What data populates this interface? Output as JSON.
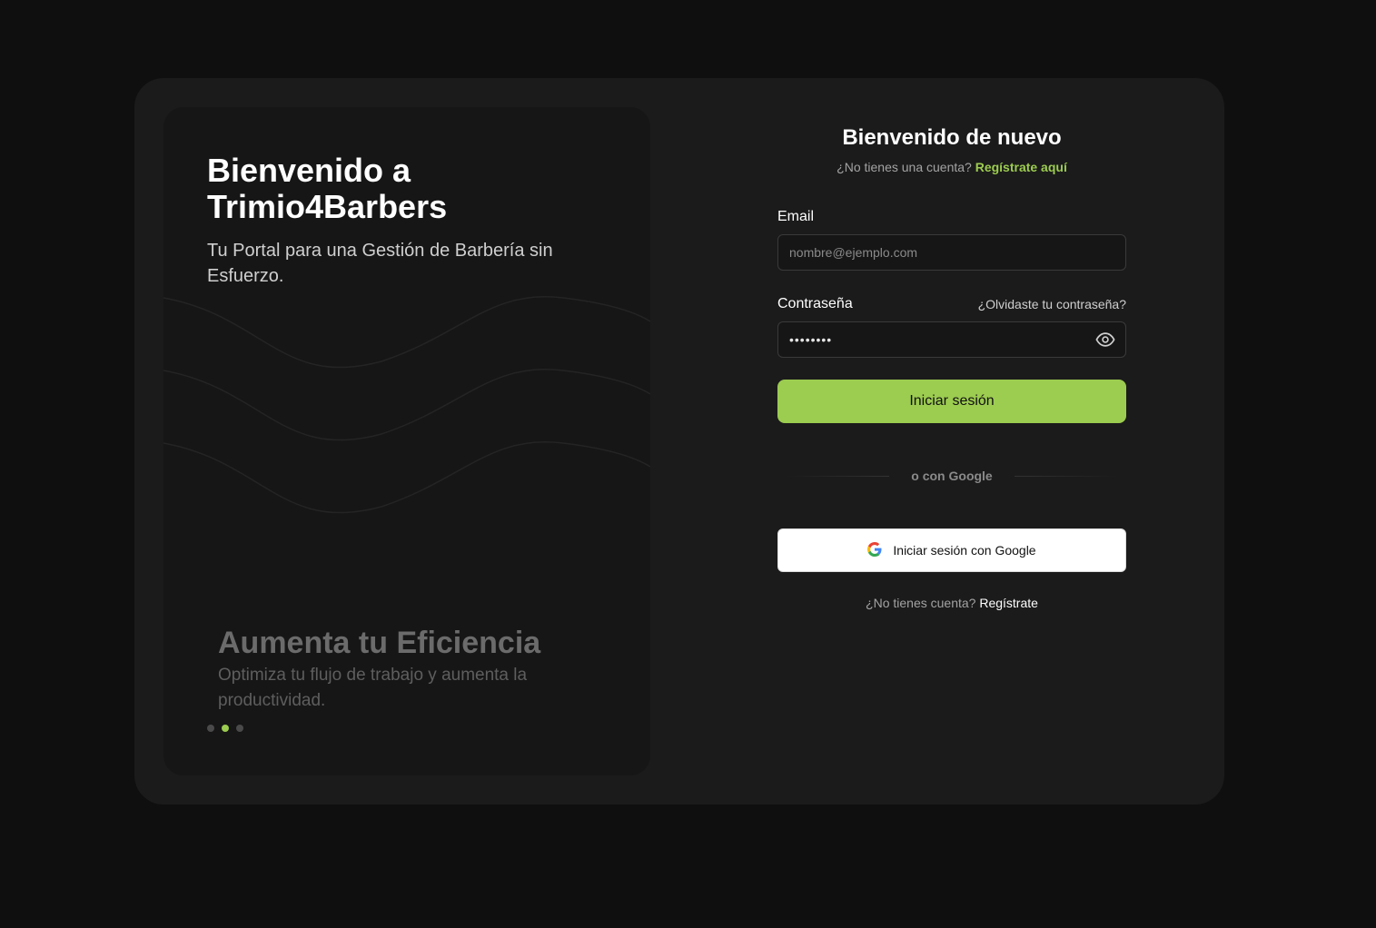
{
  "promo": {
    "title_line1": "Bienvenido a",
    "title_line2": "Trimio4Barbers",
    "subtitle": "Tu Portal para una Gestión de Barbería sin Esfuerzo.",
    "slide": {
      "title": "Aumenta tu Eficiencia",
      "text": "Optimiza tu flujo de trabajo y aumenta la productividad."
    },
    "carousel": {
      "slides": 3,
      "active_index": 1
    }
  },
  "login": {
    "title": "Bienvenido de nuevo",
    "no_account_prefix": "¿No tienes una cuenta?",
    "register_link": "Regístrate aquí",
    "email_label": "Email",
    "email_placeholder": "nombre@ejemplo.com",
    "password_label": "Contraseña",
    "forgot_link": "¿Olvidaste tu contraseña?",
    "password_value": "••••••••",
    "submit_label": "Iniciar sesión",
    "divider_text": "o con Google",
    "google_label": "Iniciar sesión con Google",
    "bottom_prefix": "¿No tienes cuenta?",
    "bottom_link": "Regístrate"
  },
  "colors": {
    "accent": "#9ccc50",
    "background": "#0f0f0f",
    "card": "#1b1b1b",
    "panel": "#161616"
  },
  "icons": {
    "password_toggle": "eye-icon",
    "google": "google-g-icon"
  }
}
